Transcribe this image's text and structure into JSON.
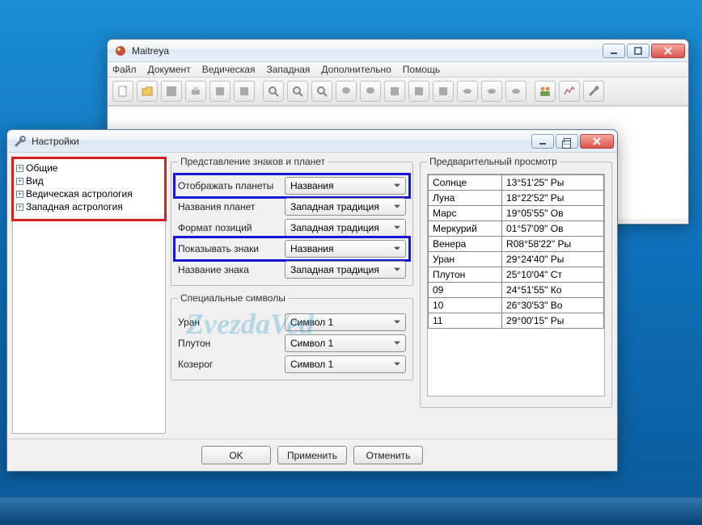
{
  "main_window": {
    "title": "Maitreya",
    "menu": [
      "Файл",
      "Документ",
      "Ведическая",
      "Западная",
      "Дополнительно",
      "Помощь"
    ]
  },
  "dialog": {
    "title": "Настройки",
    "tree": [
      {
        "label": "Общие"
      },
      {
        "label": "Вид"
      },
      {
        "label": "Ведическая астрология"
      },
      {
        "label": "Западная астрология"
      }
    ],
    "group_signs": {
      "legend": "Представление знаков и планет",
      "rows": [
        {
          "label": "Отображать планеты",
          "value": "Названия",
          "highlight": true
        },
        {
          "label": "Названия планет",
          "value": "Западная традиция"
        },
        {
          "label": "Формат позиций",
          "value": "Западная традиция"
        },
        {
          "label": "Показывать знаки",
          "value": "Названия",
          "highlight": true
        },
        {
          "label": "Название знака",
          "value": "Западная традиция"
        }
      ]
    },
    "group_symbols": {
      "legend": "Специальные символы",
      "rows": [
        {
          "label": "Уран",
          "value": "Символ 1"
        },
        {
          "label": "Плутон",
          "value": "Символ 1"
        },
        {
          "label": "Козерог",
          "value": "Символ 1"
        }
      ]
    },
    "preview": {
      "legend": "Предварительный просмотр",
      "rows": [
        {
          "name": "Солнце",
          "pos": "13°51'25\" Ры"
        },
        {
          "name": "Луна",
          "pos": "18°22'52\" Ры"
        },
        {
          "name": "Марс",
          "pos": "19°05'55\" Ов"
        },
        {
          "name": "Меркурий",
          "pos": "01°57'09\" Ов"
        },
        {
          "name": "Венера",
          "pos": "R08°58'22\" Ры"
        },
        {
          "name": "Уран",
          "pos": "29°24'40\" Ры"
        },
        {
          "name": "Плутон",
          "pos": "25°10'04\" Ст"
        },
        {
          "name": "09",
          "pos": "24°51'55\" Ко"
        },
        {
          "name": "10",
          "pos": "26°30'53\" Во"
        },
        {
          "name": "11",
          "pos": "29°00'15\" Ры"
        }
      ]
    },
    "buttons": {
      "ok": "OK",
      "apply": "Применить",
      "cancel": "Отменить"
    }
  },
  "watermark": "ZvezdaVed"
}
